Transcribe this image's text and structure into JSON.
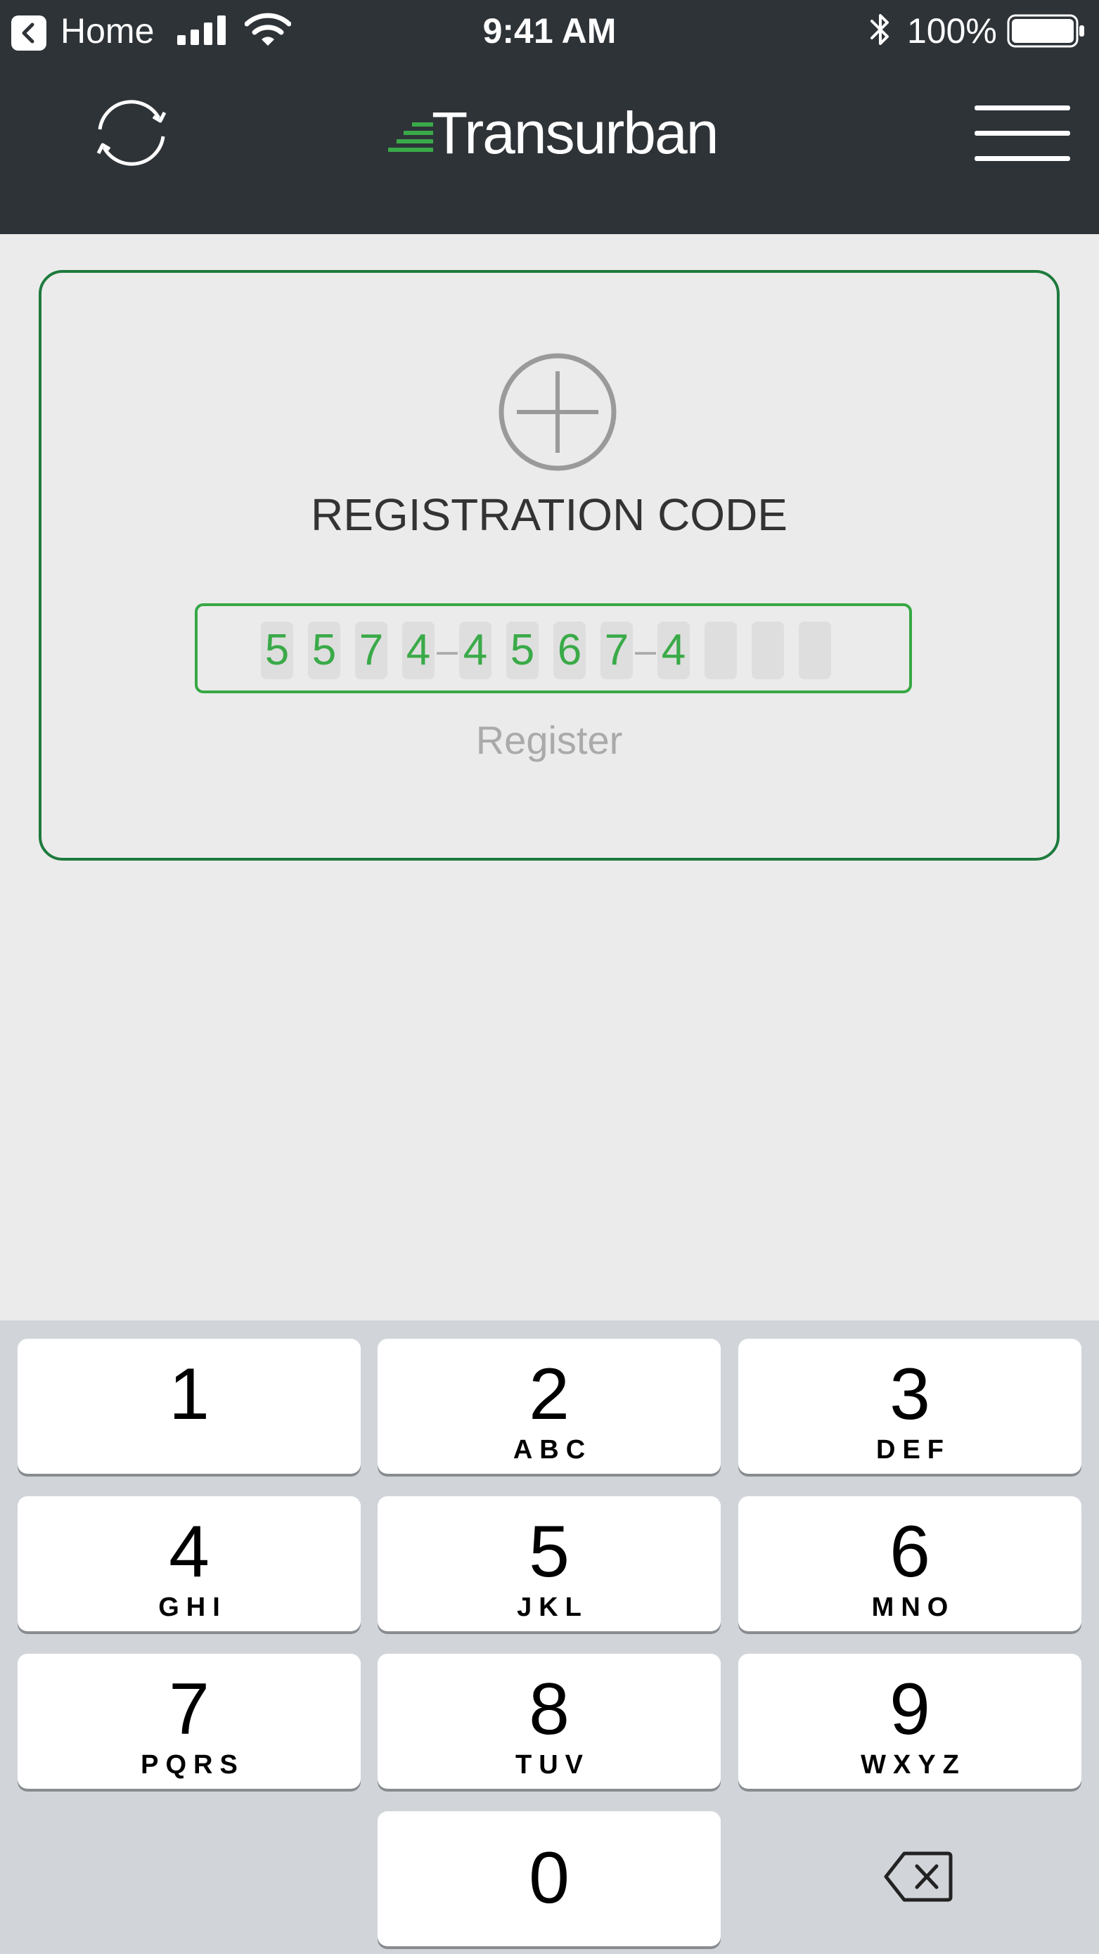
{
  "status_bar": {
    "back_label": "Home",
    "time": "9:41 AM",
    "battery": "100%",
    "icons": [
      "back-arrow-icon",
      "cellular-signal-icon",
      "wifi-icon",
      "bluetooth-icon",
      "battery-icon"
    ]
  },
  "nav": {
    "logo_text": "Transurban",
    "icons": [
      "refresh-icon",
      "hamburger-menu-icon"
    ],
    "background": "#2e3338"
  },
  "card": {
    "title": "REGISTRATION CODE",
    "code_digits": [
      "5",
      "5",
      "7",
      "4",
      "4",
      "5",
      "6",
      "7",
      "4",
      "",
      "",
      ""
    ],
    "separator": "–",
    "register_label": "Register",
    "border_color": "#1e7a3d",
    "digit_color": "#3aaa48"
  },
  "keypad": {
    "keys": [
      {
        "digit": "1",
        "letters": ""
      },
      {
        "digit": "2",
        "letters": "ABC"
      },
      {
        "digit": "3",
        "letters": "DEF"
      },
      {
        "digit": "4",
        "letters": "GHI"
      },
      {
        "digit": "5",
        "letters": "JKL"
      },
      {
        "digit": "6",
        "letters": "MNO"
      },
      {
        "digit": "7",
        "letters": "PQRS"
      },
      {
        "digit": "8",
        "letters": "TUV"
      },
      {
        "digit": "9",
        "letters": "WXYZ"
      },
      {
        "digit": "0",
        "letters": ""
      }
    ],
    "delete_icon": "delete-backspace-icon"
  }
}
